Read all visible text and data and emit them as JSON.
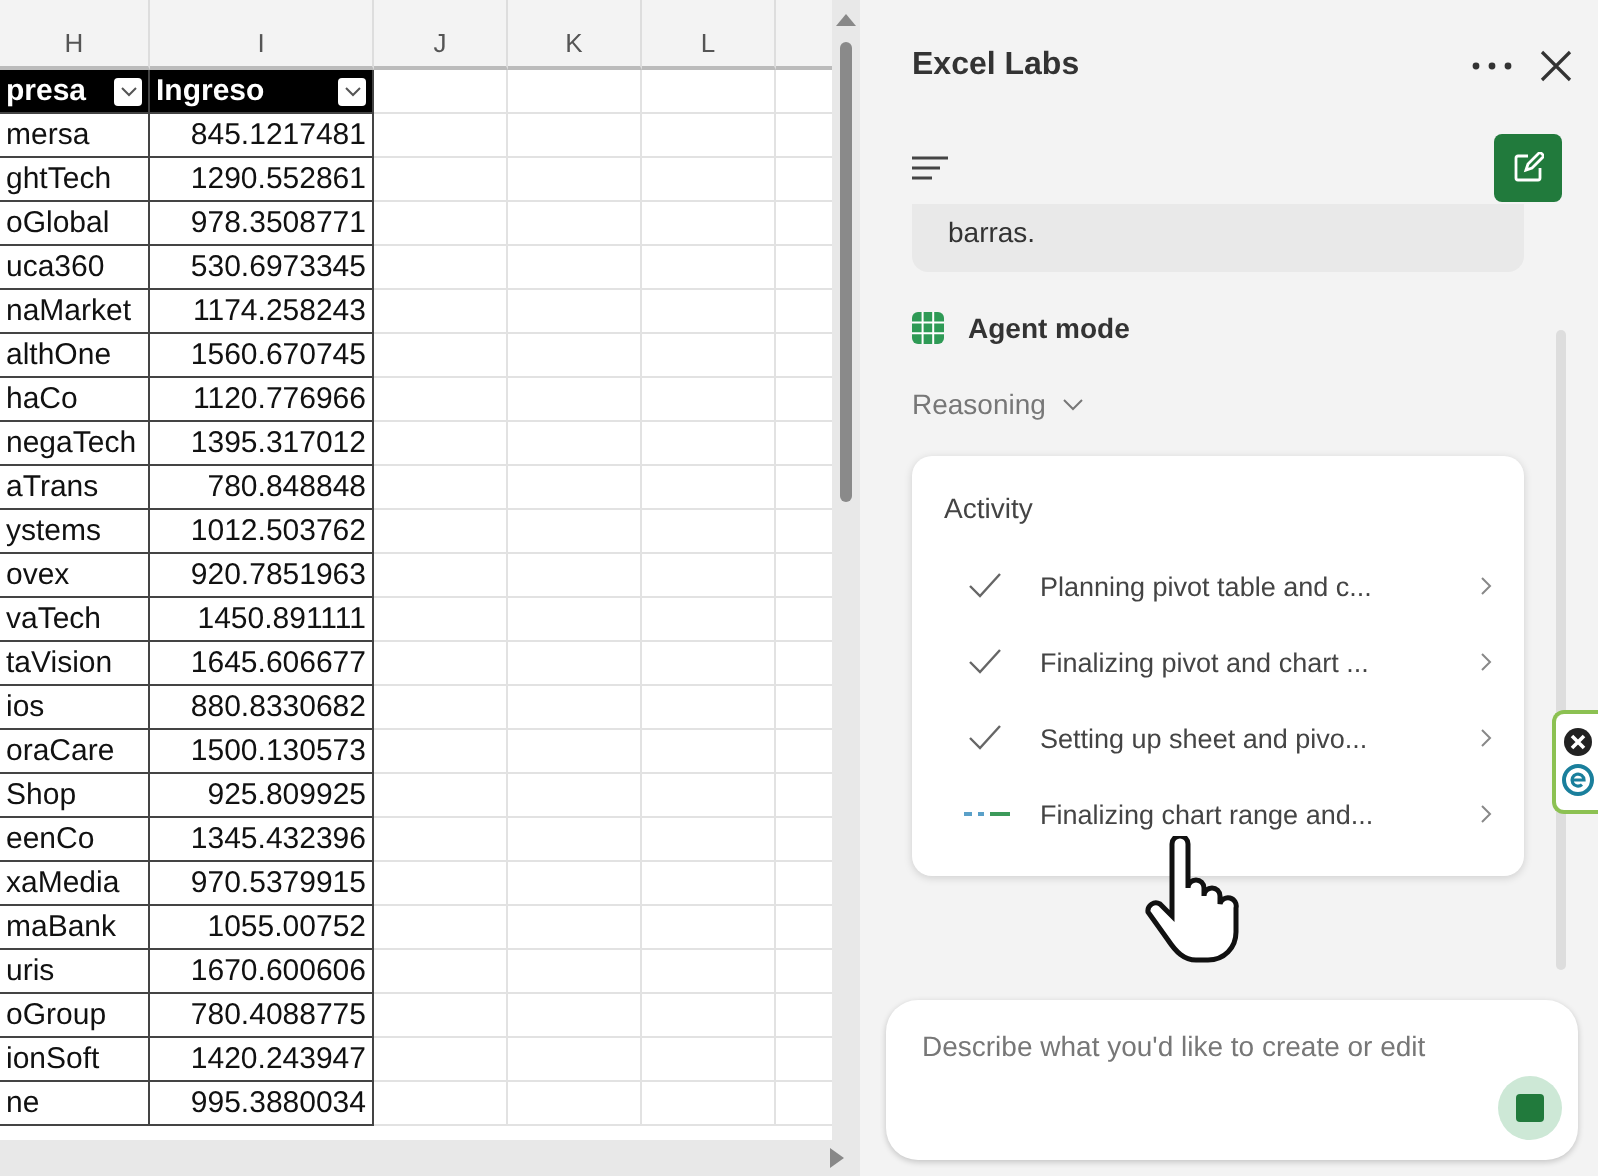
{
  "sheet": {
    "columns": [
      "H",
      "I",
      "J",
      "K",
      "L"
    ],
    "table_headers": [
      "presa",
      "Ingreso"
    ],
    "rows": [
      [
        "mersa",
        "845.1217481"
      ],
      [
        "ghtTech",
        "1290.552861"
      ],
      [
        "oGlobal",
        "978.3508771"
      ],
      [
        "uca360",
        "530.6973345"
      ],
      [
        "naMarket",
        "1174.258243"
      ],
      [
        "althOne",
        "1560.670745"
      ],
      [
        "haCo",
        "1120.776966"
      ],
      [
        "negaTech",
        "1395.317012"
      ],
      [
        "aTrans",
        "780.848848"
      ],
      [
        "ystems",
        "1012.503762"
      ],
      [
        "ovex",
        "920.7851963"
      ],
      [
        "vaTech",
        "1450.891111"
      ],
      [
        "taVision",
        "1645.606677"
      ],
      [
        "ios",
        "880.8330682"
      ],
      [
        "oraCare",
        "1500.130573"
      ],
      [
        "Shop",
        "925.809925"
      ],
      [
        "eenCo",
        "1345.432396"
      ],
      [
        "xaMedia",
        "970.5379915"
      ],
      [
        "maBank",
        "1055.00752"
      ],
      [
        "uris",
        "1670.600606"
      ],
      [
        "oGroup",
        "780.4088775"
      ],
      [
        "ionSoft",
        "1420.243947"
      ],
      [
        "ne",
        "995.3880034"
      ]
    ]
  },
  "panel": {
    "title": "Excel Labs",
    "message": "barras.",
    "mode": "Agent mode",
    "reasoning": "Reasoning",
    "activity": {
      "title": "Activity",
      "items": [
        {
          "label": "Planning pivot table and c...",
          "done": true
        },
        {
          "label": "Finalizing pivot and chart ...",
          "done": true
        },
        {
          "label": "Setting up sheet and pivo...",
          "done": true
        },
        {
          "label": "Finalizing chart range and...",
          "done": false
        }
      ]
    },
    "input": {
      "placeholder": "Describe what you'd like to create or edit"
    }
  }
}
